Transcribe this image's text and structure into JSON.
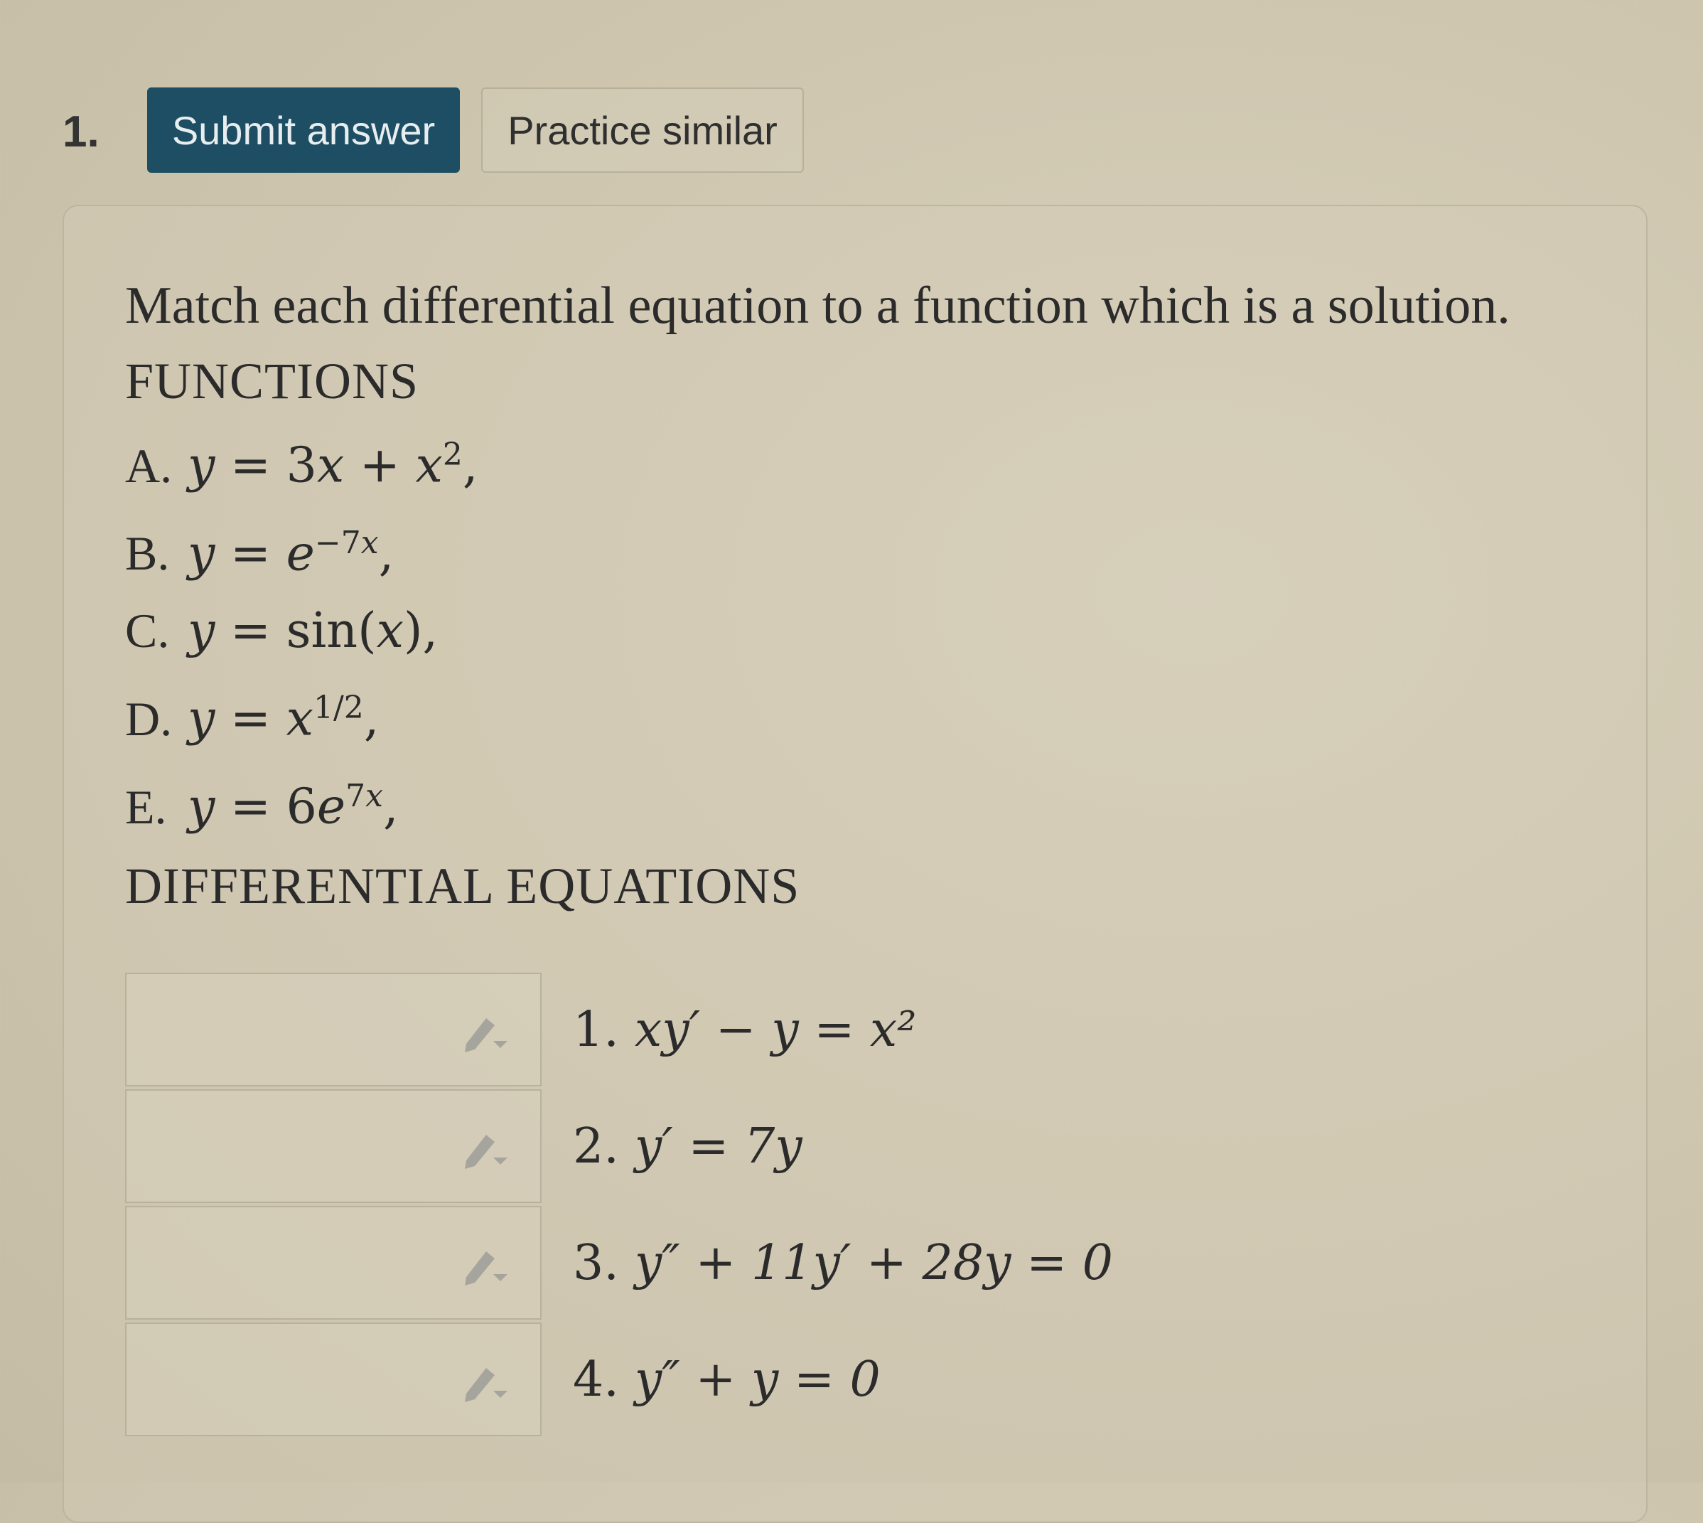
{
  "question": {
    "number": "1.",
    "submit_label": "Submit answer",
    "practice_label": "Practice similar"
  },
  "prompt": "Match each differential equation to a function which is a solution.",
  "functions_heading": "FUNCTIONS",
  "functions": [
    {
      "letter": "A.",
      "expr": "y = 3x + x²,"
    },
    {
      "letter": "B.",
      "expr": "y = e^(−7x),"
    },
    {
      "letter": "C.",
      "expr": "y = sin(x),"
    },
    {
      "letter": "D.",
      "expr": "y = x^(1/2),"
    },
    {
      "letter": "E.",
      "expr": "y = 6e^(7x),"
    }
  ],
  "equations_heading": "DIFFERENTIAL EQUATIONS",
  "equations": [
    {
      "num": "1.",
      "expr": "xy′ − y = x²",
      "answer": ""
    },
    {
      "num": "2.",
      "expr": "y′ = 7y",
      "answer": ""
    },
    {
      "num": "3.",
      "expr": "y″ + 11y′ + 28y = 0",
      "answer": ""
    },
    {
      "num": "4.",
      "expr": "y″ + y = 0",
      "answer": ""
    }
  ],
  "colors": {
    "submit_bg": "#1d4e63",
    "icon": "#9a9a92"
  },
  "icons": {
    "answer_dropdown": "pencil-dropdown-icon"
  }
}
